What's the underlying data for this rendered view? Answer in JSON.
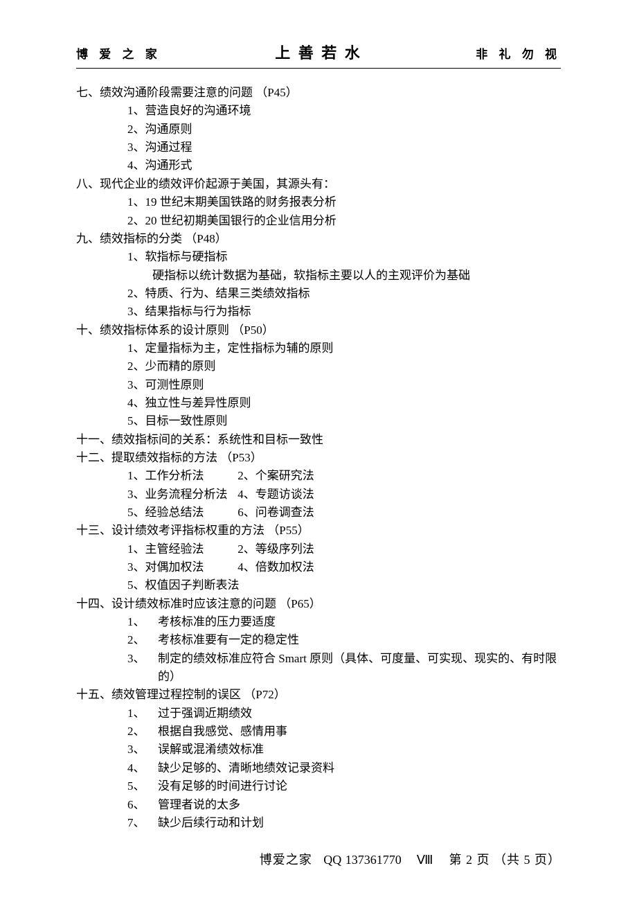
{
  "header": {
    "left": "博 爱 之 家",
    "center": "上 善 若 水",
    "right": "非 礼 勿 视"
  },
  "sections": {
    "s7": {
      "title": "七、绩效沟通阶段需要注意的问题 （P45）",
      "items": [
        "1、营造良好的沟通环境",
        "2、沟通原则",
        "3、沟通过程",
        "4、沟通形式"
      ]
    },
    "s8": {
      "title": "八、现代企业的绩效评价起源于美国，其源头有：",
      "items": [
        "1、19 世纪末期美国铁路的财务报表分析",
        "2、20 世纪初期美国银行的企业信用分析"
      ]
    },
    "s9": {
      "title": "九、绩效指标的分类 （P48）",
      "items": [
        "1、软指标与硬指标",
        "2、特质、行为、结果三类绩效指标",
        "3、结果指标与行为指标"
      ],
      "note": "硬指标以统计数据为基础，软指标主要以人的主观评价为基础"
    },
    "s10": {
      "title": "十、绩效指标体系的设计原则 （P50）",
      "items": [
        "1、定量指标为主，定性指标为辅的原则",
        "2、少而精的原则",
        "3、可测性原则",
        "4、独立性与差异性原则",
        "5、目标一致性原则"
      ]
    },
    "s11": {
      "title": "十一、绩效指标间的关系：系统性和目标一致性"
    },
    "s12": {
      "title": "十二、提取绩效指标的方法 （P53）",
      "rows": [
        [
          "1、工作分析法",
          "2、个案研究法"
        ],
        [
          "3、业务流程分析法",
          "4、专题访谈法"
        ],
        [
          "5、经验总结法",
          "6、问卷调查法"
        ]
      ]
    },
    "s13": {
      "title": "十三、设计绩效考评指标权重的方法 （P55）",
      "rows": [
        [
          "1、主管经验法",
          "2、等级序列法"
        ],
        [
          "3、对偶加权法",
          "4、倍数加权法"
        ],
        [
          "5、权值因子判断表法",
          ""
        ]
      ]
    },
    "s14": {
      "title": "十四、设计绩效标准时应该注意的问题 （P65）",
      "items": [
        {
          "n": "1、",
          "t": "考核标准的压力要适度"
        },
        {
          "n": "2、",
          "t": "考核标准要有一定的稳定性"
        },
        {
          "n": "3、",
          "t": "制定的绩效标准应符合 Smart 原则（具体、可度量、可实现、现实的、有时限的）"
        }
      ]
    },
    "s15": {
      "title": "十五、绩效管理过程控制的误区 （P72）",
      "items": [
        {
          "n": "1、",
          "t": "过于强调近期绩效"
        },
        {
          "n": "2、",
          "t": "根据自我感觉、感情用事"
        },
        {
          "n": "3、",
          "t": "误解或混淆绩效标准"
        },
        {
          "n": "4、",
          "t": "缺少足够的、清晰地绩效记录资料"
        },
        {
          "n": "5、",
          "t": "没有足够的时间进行讨论"
        },
        {
          "n": "6、",
          "t": "管理者说的太多"
        },
        {
          "n": "7、",
          "t": "缺少后续行动和计划"
        }
      ]
    }
  },
  "footer": {
    "brand": "博爱之家",
    "qq_label": "QQ",
    "qq": "137361770",
    "roman": "Ⅷ",
    "page_prefix": "第",
    "page_num": "2",
    "page_mid": "页 （共",
    "page_total": "5",
    "page_suffix": "页）"
  }
}
